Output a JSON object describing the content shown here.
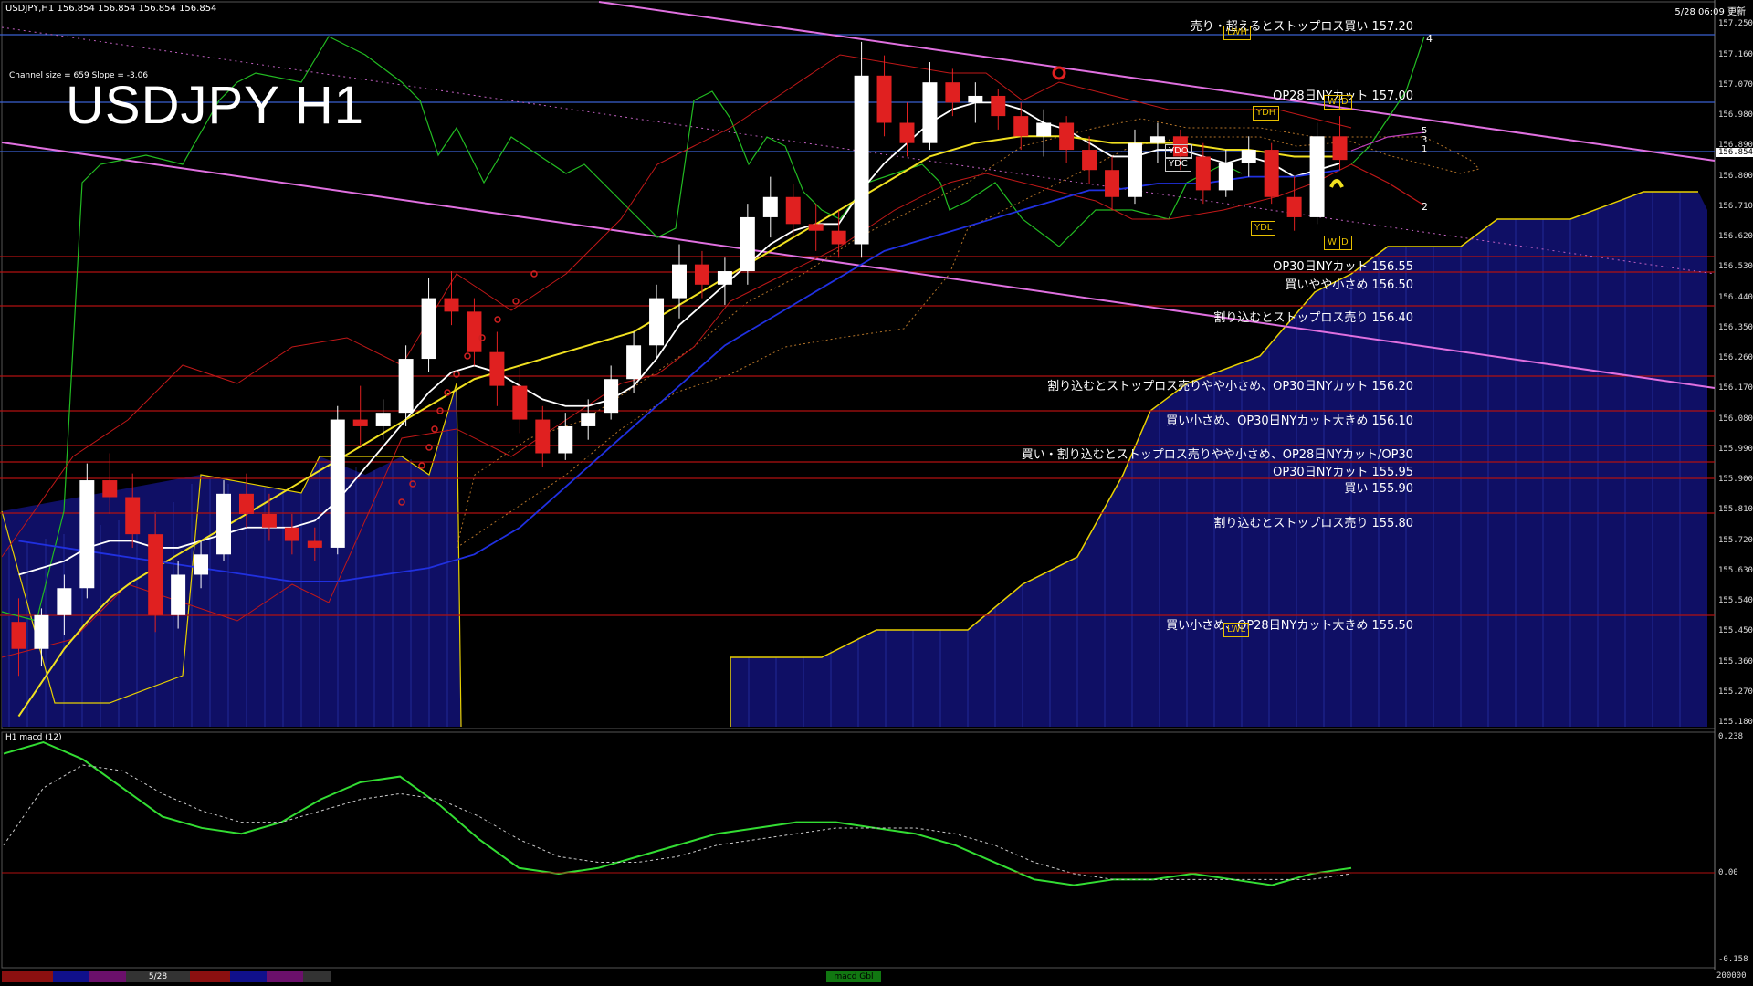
{
  "header": {
    "symbol_info": "USDJPY,H1   156.854 156.854 156.854 156.854",
    "datetime": "5/28 06:09 更新",
    "chart_title": "USDJPY H1",
    "channel_info": "Channel size = 659 Slope = -3.06"
  },
  "macd_panel": {
    "label": "H1  macd (12)",
    "axis_top": "0.238",
    "axis_zero": "0.00",
    "axis_bottom": "-0.158"
  },
  "current_price": "156.854",
  "price_axis": [
    "157.250",
    "157.160",
    "157.070",
    "156.980",
    "156.890",
    "156.800",
    "156.710",
    "156.620",
    "156.530",
    "156.440",
    "156.350",
    "156.260",
    "156.170",
    "156.080",
    "155.990",
    "155.900",
    "155.810",
    "155.720",
    "155.630",
    "155.540",
    "155.450",
    "155.360",
    "155.270",
    "155.180"
  ],
  "level_labels": [
    {
      "text": "売り・超えるとストップロス買い 157.20",
      "price": 157.2
    },
    {
      "text": "OP28日NYカット 157.00",
      "price": 157.0
    },
    {
      "text": "OP30日NYカット 156.55",
      "price": 156.55
    },
    {
      "text": "買いやや小さめ 156.50",
      "price": 156.5
    },
    {
      "text": "割り込むとストップロス売り 156.40",
      "price": 156.4
    },
    {
      "text": "割り込むとストップロス売りやや小さめ、OP30日NYカット 156.20",
      "price": 156.2
    },
    {
      "text": "買い小さめ、OP30日NYカット大きめ 156.10",
      "price": 156.1
    },
    {
      "text": "買い・割り込むとストップロス売りやや小さめ、OP28日NYカット/OP30",
      "price": 156.0
    },
    {
      "text": "OP30日NYカット 155.95",
      "price": 155.95
    },
    {
      "text": "買い 155.90",
      "price": 155.9
    },
    {
      "text": "割り込むとストップロス売り 155.80",
      "price": 155.8
    },
    {
      "text": "買い小さめ、OP28日NYカット大きめ 155.50",
      "price": 155.5
    }
  ],
  "markers": {
    "lwh": "LWH",
    "lwl": "LWL",
    "ydh": "YDH",
    "ydl": "YDL",
    "ydo": "YDO",
    "ydc": "YDC",
    "w": "W",
    "d": "D"
  },
  "projection_labels": [
    "4",
    "5",
    "3",
    "1",
    "2"
  ],
  "tabs": [
    "",
    "",
    "",
    "5/28",
    "",
    "",
    "",
    "",
    "",
    ""
  ],
  "macd_tab": "macd Gbl",
  "footer_right": "200000",
  "chart_data": {
    "type": "candlestick",
    "ylim": [
      155.18,
      157.27
    ],
    "ohlc": [
      [
        155.48,
        155.55,
        155.32,
        155.4
      ],
      [
        155.4,
        155.52,
        155.35,
        155.5
      ],
      [
        155.5,
        155.62,
        155.44,
        155.58
      ],
      [
        155.58,
        155.95,
        155.55,
        155.9
      ],
      [
        155.9,
        155.98,
        155.8,
        155.85
      ],
      [
        155.85,
        155.92,
        155.7,
        155.74
      ],
      [
        155.74,
        155.8,
        155.45,
        155.5
      ],
      [
        155.5,
        155.66,
        155.46,
        155.62
      ],
      [
        155.62,
        155.72,
        155.58,
        155.68
      ],
      [
        155.68,
        155.9,
        155.66,
        155.86
      ],
      [
        155.86,
        155.92,
        155.76,
        155.8
      ],
      [
        155.8,
        155.86,
        155.72,
        155.76
      ],
      [
        155.76,
        155.8,
        155.68,
        155.72
      ],
      [
        155.72,
        155.76,
        155.66,
        155.7
      ],
      [
        155.7,
        156.12,
        155.68,
        156.08
      ],
      [
        156.08,
        156.18,
        156.0,
        156.06
      ],
      [
        156.06,
        156.14,
        156.02,
        156.1
      ],
      [
        156.1,
        156.3,
        156.06,
        156.26
      ],
      [
        156.26,
        156.5,
        156.22,
        156.44
      ],
      [
        156.44,
        156.52,
        156.36,
        156.4
      ],
      [
        156.4,
        156.44,
        156.24,
        156.28
      ],
      [
        156.28,
        156.34,
        156.12,
        156.18
      ],
      [
        156.18,
        156.24,
        156.04,
        156.08
      ],
      [
        156.08,
        156.12,
        155.94,
        155.98
      ],
      [
        155.98,
        156.1,
        155.96,
        156.06
      ],
      [
        156.06,
        156.14,
        156.02,
        156.1
      ],
      [
        156.1,
        156.24,
        156.08,
        156.2
      ],
      [
        156.2,
        156.34,
        156.16,
        156.3
      ],
      [
        156.3,
        156.48,
        156.26,
        156.44
      ],
      [
        156.44,
        156.6,
        156.38,
        156.54
      ],
      [
        156.54,
        156.58,
        156.44,
        156.48
      ],
      [
        156.48,
        156.56,
        156.42,
        156.52
      ],
      [
        156.52,
        156.72,
        156.48,
        156.68
      ],
      [
        156.68,
        156.8,
        156.62,
        156.74
      ],
      [
        156.74,
        156.78,
        156.62,
        156.66
      ],
      [
        156.66,
        156.72,
        156.58,
        156.64
      ],
      [
        156.64,
        156.7,
        156.56,
        156.6
      ],
      [
        156.6,
        157.2,
        156.56,
        157.1
      ],
      [
        157.1,
        157.16,
        156.92,
        156.96
      ],
      [
        156.96,
        157.02,
        156.86,
        156.9
      ],
      [
        156.9,
        157.14,
        156.88,
        157.08
      ],
      [
        157.08,
        157.12,
        156.98,
        157.02
      ],
      [
        157.02,
        157.08,
        156.96,
        157.04
      ],
      [
        157.04,
        157.06,
        156.94,
        156.98
      ],
      [
        156.98,
        157.02,
        156.88,
        156.92
      ],
      [
        156.92,
        157.0,
        156.86,
        156.96
      ],
      [
        156.96,
        156.98,
        156.84,
        156.88
      ],
      [
        156.88,
        156.92,
        156.78,
        156.82
      ],
      [
        156.82,
        156.86,
        156.7,
        156.74
      ],
      [
        156.74,
        156.94,
        156.72,
        156.9
      ],
      [
        156.9,
        156.96,
        156.84,
        156.92
      ],
      [
        156.92,
        156.94,
        156.82,
        156.86
      ],
      [
        156.86,
        156.9,
        156.72,
        156.76
      ],
      [
        156.76,
        156.88,
        156.74,
        156.84
      ],
      [
        156.84,
        156.92,
        156.8,
        156.88
      ],
      [
        156.88,
        156.9,
        156.72,
        156.74
      ],
      [
        156.74,
        156.8,
        156.64,
        156.68
      ],
      [
        156.68,
        156.96,
        156.66,
        156.92
      ],
      [
        156.92,
        156.98,
        156.82,
        156.85
      ]
    ],
    "series": [
      {
        "name": "",
        "color": "#ffffff",
        "values": [
          155.62,
          155.64,
          155.66,
          155.7,
          155.72,
          155.72,
          155.7,
          155.7,
          155.72,
          155.74,
          155.76,
          155.76,
          155.76,
          155.78,
          155.84,
          155.92,
          156.0,
          156.08,
          156.16,
          156.22,
          156.24,
          156.22,
          156.18,
          156.14,
          156.12,
          156.12,
          156.14,
          156.18,
          156.26,
          156.36,
          156.42,
          156.48,
          156.54,
          156.6,
          156.64,
          156.66,
          156.66,
          156.76,
          156.84,
          156.9,
          156.96,
          157.0,
          157.02,
          157.02,
          157.0,
          156.96,
          156.94,
          156.9,
          156.86,
          156.86,
          156.88,
          156.88,
          156.86,
          156.84,
          156.86,
          156.84,
          156.8,
          156.82,
          156.84
        ]
      },
      {
        "name": "",
        "color": "#f0e020",
        "values": [
          155.2,
          155.3,
          155.4,
          155.48,
          155.55,
          155.6,
          155.64,
          155.68,
          155.72,
          155.76,
          155.8,
          155.84,
          155.88,
          155.92,
          155.96,
          156.0,
          156.04,
          156.08,
          156.12,
          156.16,
          156.2,
          156.22,
          156.24,
          156.26,
          156.28,
          156.3,
          156.32,
          156.34,
          156.38,
          156.42,
          156.46,
          156.5,
          156.54,
          156.58,
          156.62,
          156.66,
          156.7,
          156.74,
          156.78,
          156.82,
          156.86,
          156.88,
          156.9,
          156.91,
          156.92,
          156.92,
          156.92,
          156.91,
          156.9,
          156.9,
          156.9,
          156.9,
          156.89,
          156.88,
          156.88,
          156.87,
          156.86,
          156.86,
          156.86
        ]
      },
      {
        "name": "",
        "color": "#2030e0",
        "values": [
          155.72,
          155.71,
          155.7,
          155.69,
          155.68,
          155.67,
          155.66,
          155.65,
          155.64,
          155.63,
          155.62,
          155.61,
          155.6,
          155.6,
          155.6,
          155.61,
          155.62,
          155.63,
          155.64,
          155.66,
          155.68,
          155.72,
          155.76,
          155.82,
          155.88,
          155.94,
          156.0,
          156.06,
          156.12,
          156.18,
          156.24,
          156.3,
          156.34,
          156.38,
          156.42,
          156.46,
          156.5,
          156.54,
          156.58,
          156.6,
          156.62,
          156.64,
          156.66,
          156.68,
          156.7,
          156.72,
          156.74,
          156.76,
          156.76,
          156.77,
          156.78,
          156.78,
          156.78,
          156.79,
          156.8,
          156.8,
          156.8,
          156.81,
          156.82
        ]
      }
    ],
    "macd": [
      0.21,
      0.23,
      0.2,
      0.15,
      0.1,
      0.08,
      0.07,
      0.09,
      0.13,
      0.16,
      0.17,
      0.12,
      0.06,
      0.01,
      0.0,
      0.01,
      0.03,
      0.05,
      0.07,
      0.08,
      0.09,
      0.09,
      0.08,
      0.07,
      0.05,
      0.02,
      -0.01,
      -0.02,
      -0.01,
      -0.01,
      0.0,
      -0.01,
      -0.02,
      0.0,
      0.01
    ],
    "macd_signal": [
      0.05,
      0.15,
      0.19,
      0.18,
      0.14,
      0.11,
      0.09,
      0.09,
      0.11,
      0.13,
      0.14,
      0.13,
      0.1,
      0.06,
      0.03,
      0.02,
      0.02,
      0.03,
      0.05,
      0.06,
      0.07,
      0.08,
      0.08,
      0.08,
      0.07,
      0.05,
      0.02,
      0.0,
      -0.01,
      -0.01,
      -0.01,
      -0.01,
      -0.01,
      -0.01,
      0.0
    ],
    "macd_ylim": [
      -0.158,
      0.238
    ]
  }
}
